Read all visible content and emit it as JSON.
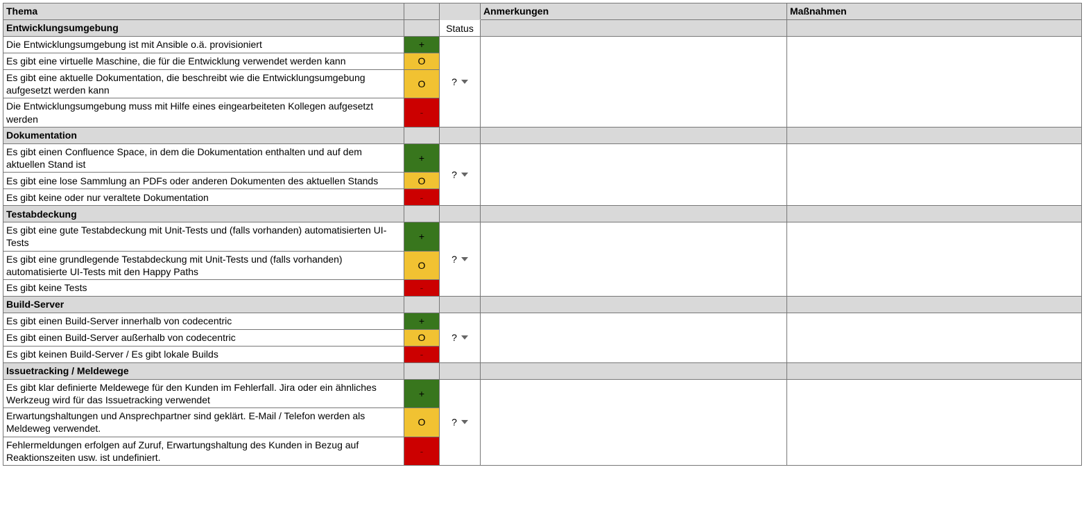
{
  "headers": {
    "thema": "Thema",
    "anmerkungen": "Anmerkungen",
    "massnahmen": "Maßnahmen",
    "status": "Status"
  },
  "colors": {
    "green": "#38761d",
    "yellow": "#F1C232",
    "red": "#CC0000"
  },
  "symbols": {
    "plus": "+",
    "circle": "O",
    "minus": "-"
  },
  "sections": [
    {
      "title": "Entwicklungsumgebung",
      "status": "?",
      "items": [
        {
          "text": "Die Entwicklungsumgebung ist mit Ansible o.ä. provisioniert",
          "rag": "plus"
        },
        {
          "text": "Es gibt eine virtuelle Maschine, die für die Entwicklung verwendet werden kann",
          "rag": "circle"
        },
        {
          "text": "Es gibt eine aktuelle Dokumentation, die beschreibt wie die Entwicklungsumgebung aufgesetzt werden kann",
          "rag": "circle"
        },
        {
          "text": "Die Entwicklungsumgebung muss mit Hilfe eines eingearbeiteten Kollegen aufgesetzt werden",
          "rag": "minus"
        }
      ]
    },
    {
      "title": "Dokumentation",
      "status": "?",
      "items": [
        {
          "text": "Es gibt einen Confluence Space, in dem die Dokumentation enthalten und auf dem aktuellen Stand ist",
          "rag": "plus"
        },
        {
          "text": "Es gibt eine lose Sammlung an PDFs oder anderen Dokumenten des aktuellen Stands",
          "rag": "circle"
        },
        {
          "text": "Es gibt keine oder nur veraltete Dokumentation",
          "rag": "minus"
        }
      ]
    },
    {
      "title": "Testabdeckung",
      "status": "?",
      "items": [
        {
          "text": "Es gibt eine gute Testabdeckung mit Unit-Tests und (falls vorhanden) automatisierten UI-Tests",
          "rag": "plus"
        },
        {
          "text": "Es gibt eine grundlegende Testabdeckung mit Unit-Tests und (falls vorhanden) automatisierte UI-Tests mit den Happy Paths",
          "rag": "circle"
        },
        {
          "text": "Es gibt keine Tests",
          "rag": "minus"
        }
      ]
    },
    {
      "title": "Build-Server",
      "status": "?",
      "items": [
        {
          "text": "Es gibt einen Build-Server innerhalb von codecentric",
          "rag": "plus"
        },
        {
          "text": "Es gibt einen Build-Server außerhalb von codecentric",
          "rag": "circle"
        },
        {
          "text": "Es gibt keinen Build-Server / Es gibt lokale Builds",
          "rag": "minus"
        }
      ]
    },
    {
      "title": "Issuetracking / Meldewege",
      "status": "?",
      "items": [
        {
          "text": "Es gibt klar definierte Meldewege für den Kunden im Fehlerfall. Jira oder ein ähnliches Werkzeug wird für das Issuetracking verwendet",
          "rag": "plus"
        },
        {
          "text": "Erwartungshaltungen und Ansprechpartner sind geklärt. E-Mail / Telefon werden als Meldeweg verwendet.",
          "rag": "circle"
        },
        {
          "text": "Fehlermeldungen erfolgen auf Zuruf, Erwartungshaltung des Kunden in Bezug auf Reaktionszeiten usw. ist undefiniert.",
          "rag": "minus"
        }
      ]
    }
  ]
}
